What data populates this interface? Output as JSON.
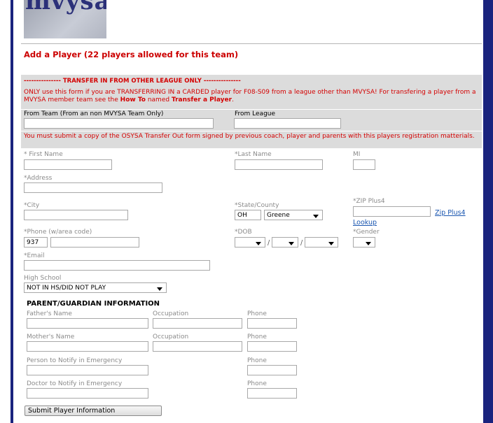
{
  "logo": {
    "text": "mvysa"
  },
  "page_title": "Add a Player (22 players allowed for this team)",
  "transfer": {
    "heading": "--------------- TRANSFER IN FROM OTHER LEAGUE ONLY ---------------",
    "notice_part1": "ONLY use this form if you are TRANSFERRING IN a CARDED player for F08-S09 from a league other than MVYSA! For transfering a player from a MVYSA member team see the ",
    "notice_howto": "How To",
    "notice_part2": " named ",
    "notice_link": "Transfer a Player",
    "notice_end": ".",
    "from_team_label": "From Team (From an non MVYSA Team Only)",
    "from_team_value": "",
    "from_league_label": "From League",
    "from_league_value": "",
    "osysa_notice": "You must submit a copy of the OSYSA Transfer Out form signed by previous coach, player and parents with this players registration matterials."
  },
  "form": {
    "first_name_label": "First Name",
    "last_name_label": "Last Name",
    "mi_label": "MI",
    "address_label": "Address",
    "city_label": "City",
    "state_county_label": "State/County",
    "state_value": "OH",
    "county_value": "Greene",
    "zip_label": "ZIP Plus4",
    "zip_lookup_link_1": "Zip Plus4",
    "zip_lookup_link_2": "Lookup",
    "phone_label": "Phone (w/area code)",
    "phone_area_value": "937",
    "phone_number_value": "",
    "dob_label": "DOB",
    "dob_month": "",
    "dob_day": "",
    "dob_year": "",
    "dob_sep": "/",
    "gender_label": "Gender",
    "gender_value": "",
    "email_label": "Email",
    "high_school_label": "High School",
    "high_school_value": "NOT IN HS/DID NOT PLAY",
    "required_mark": "*"
  },
  "parent": {
    "heading": "PARENT/GUARDIAN INFORMATION",
    "fathers_name_label": "Father's Name",
    "father_occupation_label": "Occupation",
    "father_phone_label": "Phone",
    "mothers_name_label": "Mother's Name",
    "mother_occupation_label": "Occupation",
    "mother_phone_label": "Phone",
    "emergency_label": "Person to Notify in Emergency",
    "emergency_phone_label": "Phone",
    "doctor_label": "Doctor to Notify in Emergency",
    "doctor_phone_label": "Phone"
  },
  "submit_label": "Submit Player Information",
  "colors": {
    "accent_red": "#cc0000",
    "border_blue": "#1a237e",
    "link_blue": "#1a56b0",
    "panel_gray": "#dcdcdc"
  }
}
